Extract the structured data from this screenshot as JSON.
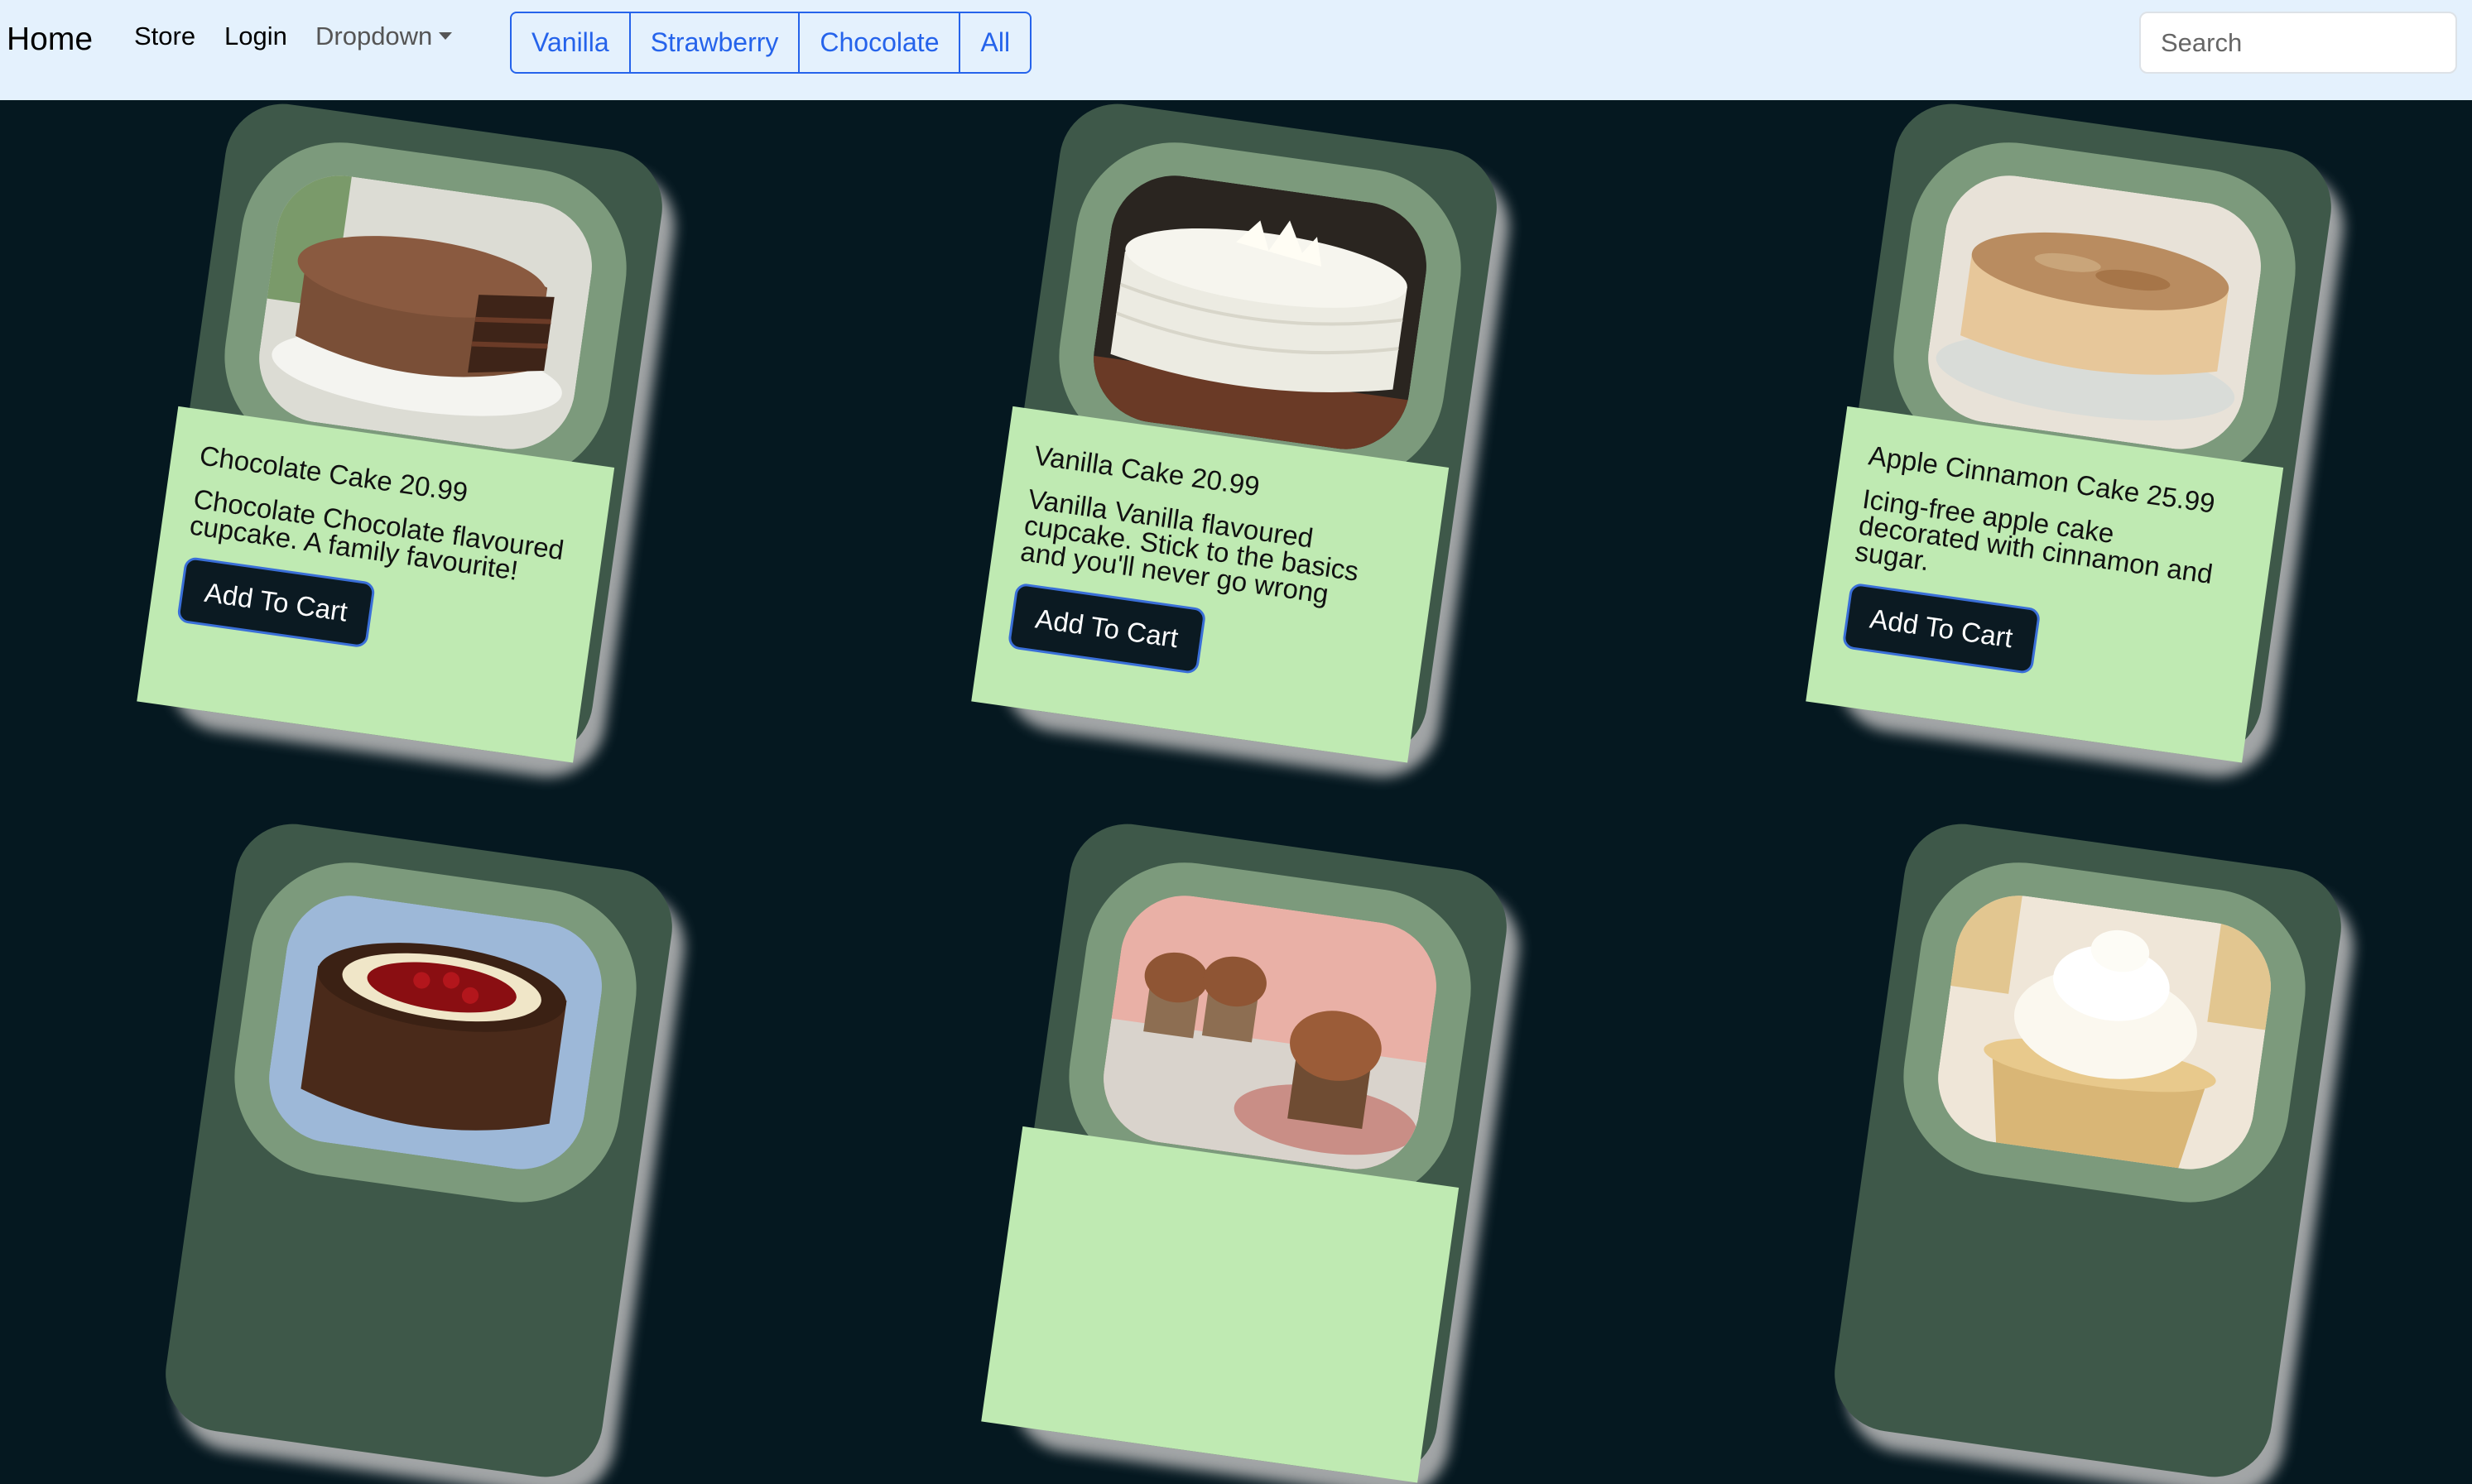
{
  "navbar": {
    "brand": "Home",
    "links": [
      "Store",
      "Login"
    ],
    "dropdown_label": "Dropdown",
    "filters": [
      "Vanilla",
      "Strawberry",
      "Chocolate",
      "All"
    ],
    "search_placeholder": "Search"
  },
  "products": [
    {
      "title": "Chocolate Cake 20.99",
      "description": "Chocolate Chocolate flavoured cupcake. A family favourite!",
      "button": "Add To Cart",
      "image": "chocolate-cake"
    },
    {
      "title": "Vanilla Cake 20.99",
      "description": "Vanilla Vanilla flavoured cupcake. Stick to the basics and you'll never go wrong",
      "button": "Add To Cart",
      "image": "vanilla-cake"
    },
    {
      "title": "Apple Cinnamon Cake 25.99",
      "description": "Icing-free apple cake decorated with cinnamon and sugar.",
      "button": "Add To Cart",
      "image": "apple-cinnamon-cake"
    },
    {
      "image": "black-forest-cake"
    },
    {
      "image": "chocolate-cupcakes"
    },
    {
      "image": "vanilla-cupcake"
    }
  ]
}
